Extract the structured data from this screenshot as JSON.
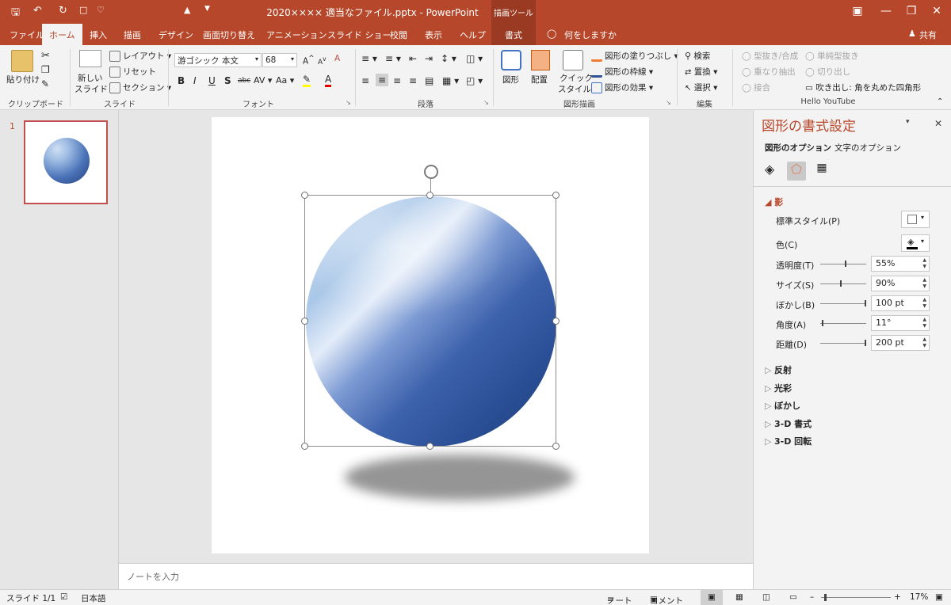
{
  "window": {
    "title": "2020××××  適当なファイル.pptx  -  PowerPoint",
    "tool_tab": "描画ツール"
  },
  "quick_access": {
    "save_icon": "save-icon",
    "undo_icon": "undo-icon",
    "redo_icon": "redo-icon"
  },
  "tabs": {
    "file": "ファイル",
    "home": "ホーム",
    "insert": "挿入",
    "draw": "描画",
    "design": "デザイン",
    "transitions": "画面切り替え",
    "animations": "アニメーション",
    "slideshow": "スライド ショー",
    "review": "校閲",
    "view": "表示",
    "help": "ヘルプ",
    "format": "書式",
    "tellme": "何をしますか",
    "share": "共有"
  },
  "ribbon": {
    "clipboard": {
      "paste": "貼り付け",
      "label": "クリップボード"
    },
    "slides": {
      "new_slide_1": "新しい",
      "new_slide_2": "スライド",
      "layout": "レイアウト",
      "reset": "リセット",
      "section": "セクション",
      "label": "スライド"
    },
    "font": {
      "name": "游ゴシック 本文",
      "size": "68",
      "label": "フォント"
    },
    "paragraph": {
      "label": "段落"
    },
    "drawing": {
      "shapes": "図形",
      "arrange": "配置",
      "quick_style_1": "クイック",
      "quick_style_2": "スタイル",
      "fill": "図形の塗りつぶし",
      "outline": "図形の枠線",
      "effects": "図形の効果",
      "label": "図形描画"
    },
    "editing": {
      "find": "検索",
      "replace": "置換",
      "select": "選択",
      "label": "編集"
    },
    "hello": {
      "cut_merge": "型抜き/合成",
      "simple_cut": "単純型抜き",
      "overlap_extract": "重なり抽出",
      "cut_out": "切り出し",
      "join": "接合",
      "callout": "吹き出し: 角を丸めた四角形",
      "label": "Hello YouTube"
    }
  },
  "thumbnails": {
    "slide_number": "1"
  },
  "notes": {
    "placeholder": "ノートを入力"
  },
  "format_pane": {
    "title": "図形の書式設定",
    "tab_shape": "図形のオプション",
    "tab_text": "文字のオプション",
    "section_shadow": "影",
    "preset_label": "標準スタイル(P)",
    "color_label": "色(C)",
    "rows": [
      {
        "label": "透明度(T)",
        "value": "55%",
        "fraction": 0.55
      },
      {
        "label": "サイズ(S)",
        "value": "90%",
        "fraction": 0.45
      },
      {
        "label": "ぼかし(B)",
        "value": "100 pt",
        "fraction": 1.0
      },
      {
        "label": "角度(A)",
        "value": "11°",
        "fraction": 0.03
      },
      {
        "label": "距離(D)",
        "value": "200 pt",
        "fraction": 1.0
      }
    ],
    "sections": {
      "reflection": "反射",
      "glow": "光彩",
      "soft_edges": "ぼかし",
      "format_3d": "3-D 書式",
      "rotation_3d": "3-D 回転"
    }
  },
  "status": {
    "slide": "スライド 1/1",
    "language": "日本語",
    "notes": "ノート",
    "comments": "コメント",
    "zoom": "17%"
  },
  "colors": {
    "accent": "#b7472a",
    "shape_dark": "#2a4f96",
    "shape_light": "#d8e6f6"
  }
}
